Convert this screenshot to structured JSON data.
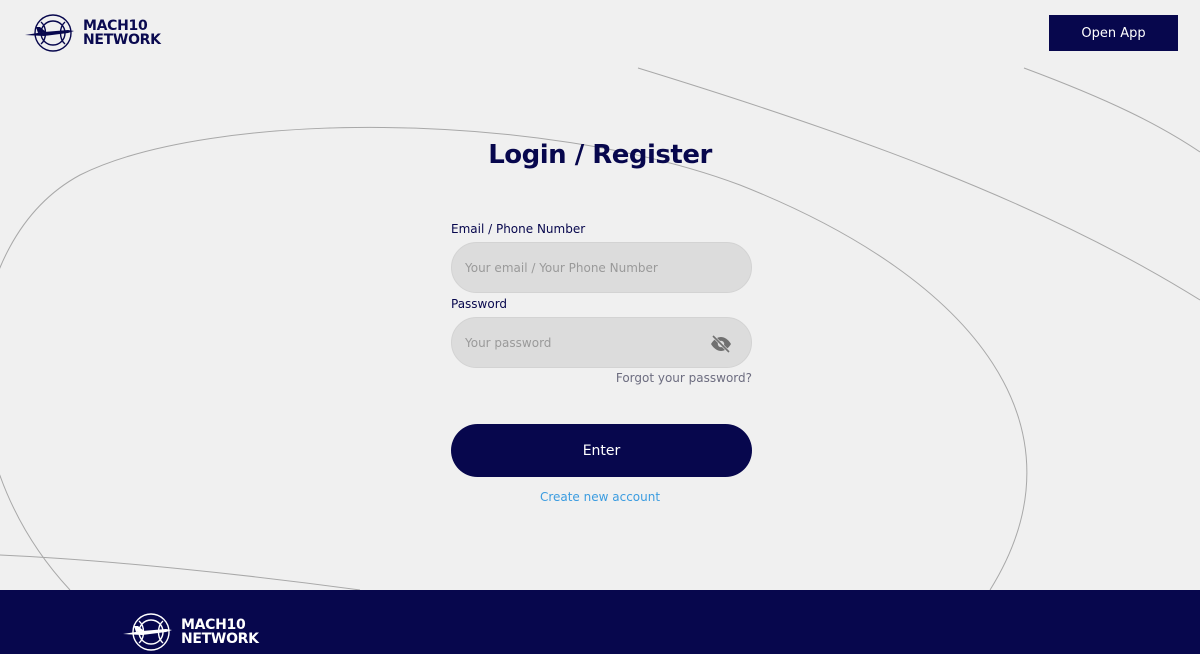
{
  "header": {
    "logo": {
      "line1": "MACH10",
      "line2": "NETWORK",
      "icon": "globe-plane-logo-icon"
    },
    "open_app_label": "Open App"
  },
  "login": {
    "title": "Login / Register",
    "email_label": "Email / Phone Number",
    "email_placeholder": "Your email / Your Phone Number",
    "email_value": "",
    "password_label": "Password",
    "password_placeholder": "Your password",
    "password_value": "",
    "password_toggle_icon": "eye-slash-icon",
    "forgot_label": "Forgot your password?",
    "enter_label": "Enter",
    "create_label": "Create new account"
  },
  "footer": {
    "logo": {
      "line1": "MACH10",
      "line2": "NETWORK",
      "icon": "globe-plane-logo-icon"
    }
  },
  "colors": {
    "brand_navy": "#07074d",
    "background": "#f0f0f0",
    "input_bg": "#dcdcdc",
    "link_blue": "#3b9ce0"
  }
}
